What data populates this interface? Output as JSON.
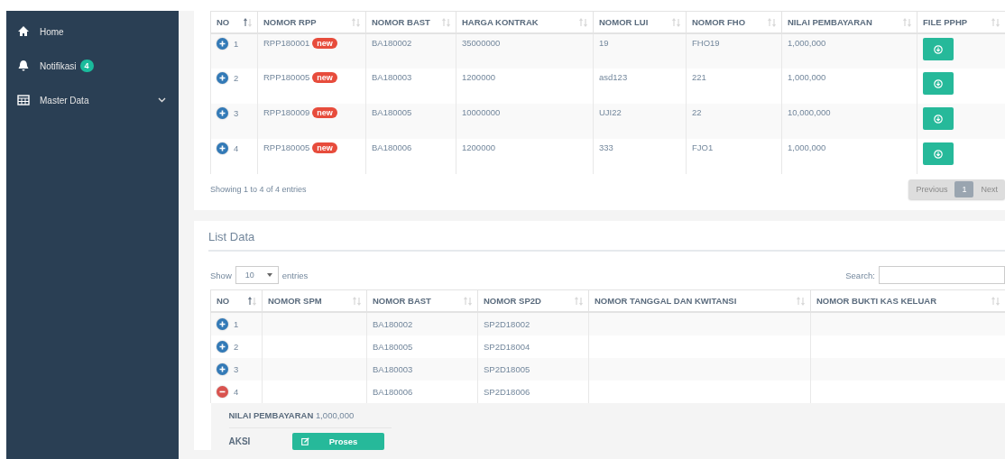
{
  "sidebar": {
    "items": [
      {
        "label": "Home",
        "caret": false
      },
      {
        "label": "Notifikasi",
        "badge": "4",
        "caret": false
      },
      {
        "label": "Master Data",
        "caret": true
      }
    ]
  },
  "table": {
    "columns": [
      {
        "label": "NO",
        "sorted": true
      },
      {
        "label": "NOMOR RPP",
        "sorted": false
      },
      {
        "label": "NOMOR BAST",
        "sorted": false
      },
      {
        "label": "HARGA KONTRAK",
        "sorted": false
      },
      {
        "label": "NOMOR LUI",
        "sorted": false
      },
      {
        "label": "NOMOR FHO",
        "sorted": false
      },
      {
        "label": "NILAI PEMBAYARAN",
        "sorted": false
      },
      {
        "label": "FILE PPHP",
        "sorted": false
      }
    ],
    "rows": [
      {
        "expanded": false,
        "badge": "new",
        "cells": [
          "1",
          "RPP180001",
          "BA180002",
          "35000000",
          "19",
          "FHO19",
          "1,000,000"
        ]
      },
      {
        "expanded": false,
        "badge": "new",
        "cells": [
          "2",
          "RPP180005",
          "BA180003",
          "1200000",
          "asd123",
          "221",
          "1,000,000"
        ]
      },
      {
        "expanded": false,
        "badge": "new",
        "cells": [
          "3",
          "RPP180009",
          "BA180005",
          "10000000",
          "UJI22",
          "22",
          "10,000,000"
        ]
      },
      {
        "expanded": false,
        "badge": "new",
        "cells": [
          "4",
          "RPP180005",
          "BA180006",
          "1200000",
          "333",
          "FJO1",
          "1,000,000"
        ]
      }
    ],
    "info": "Showing 1 to 4 of 4 entries",
    "pagination": [
      {
        "label": "Previous",
        "selected": false
      },
      {
        "label": "1",
        "selected": true
      },
      {
        "label": "Next",
        "selected": false
      }
    ]
  },
  "list_data": {
    "title": "List Data",
    "length_label": "Show",
    "length_value": "10",
    "length_suffix": "entries",
    "search_label": "Search:",
    "columns": [
      {
        "label": "NO",
        "sorted": true
      },
      {
        "label": "NOMOR SPM",
        "sorted": false
      },
      {
        "label": "NOMOR BAST",
        "sorted": false
      },
      {
        "label": "NOMOR SP2D",
        "sorted": false
      },
      {
        "label": "NOMOR TANGGAL DAN KWITANSI",
        "sorted": false
      },
      {
        "label": "NOMOR BUKTI KAS KELUAR",
        "sorted": false
      }
    ],
    "rows": [
      {
        "expanded": false,
        "cells": [
          "1",
          "",
          "BA180002",
          "SP2D18002",
          "",
          ""
        ]
      },
      {
        "expanded": false,
        "cells": [
          "2",
          "",
          "BA180005",
          "SP2D18004",
          "",
          ""
        ]
      },
      {
        "expanded": false,
        "cells": [
          "3",
          "",
          "BA180003",
          "SP2D18005",
          "",
          ""
        ]
      },
      {
        "expanded": true,
        "cells": [
          "4",
          "",
          "BA180006",
          "SP2D18006",
          "",
          ""
        ],
        "detail": {
          "label": "NILAI PEMBAYARAN",
          "value": "1,000,000",
          "action_label": "AKSI",
          "action_button": "Proses"
        }
      }
    ]
  }
}
